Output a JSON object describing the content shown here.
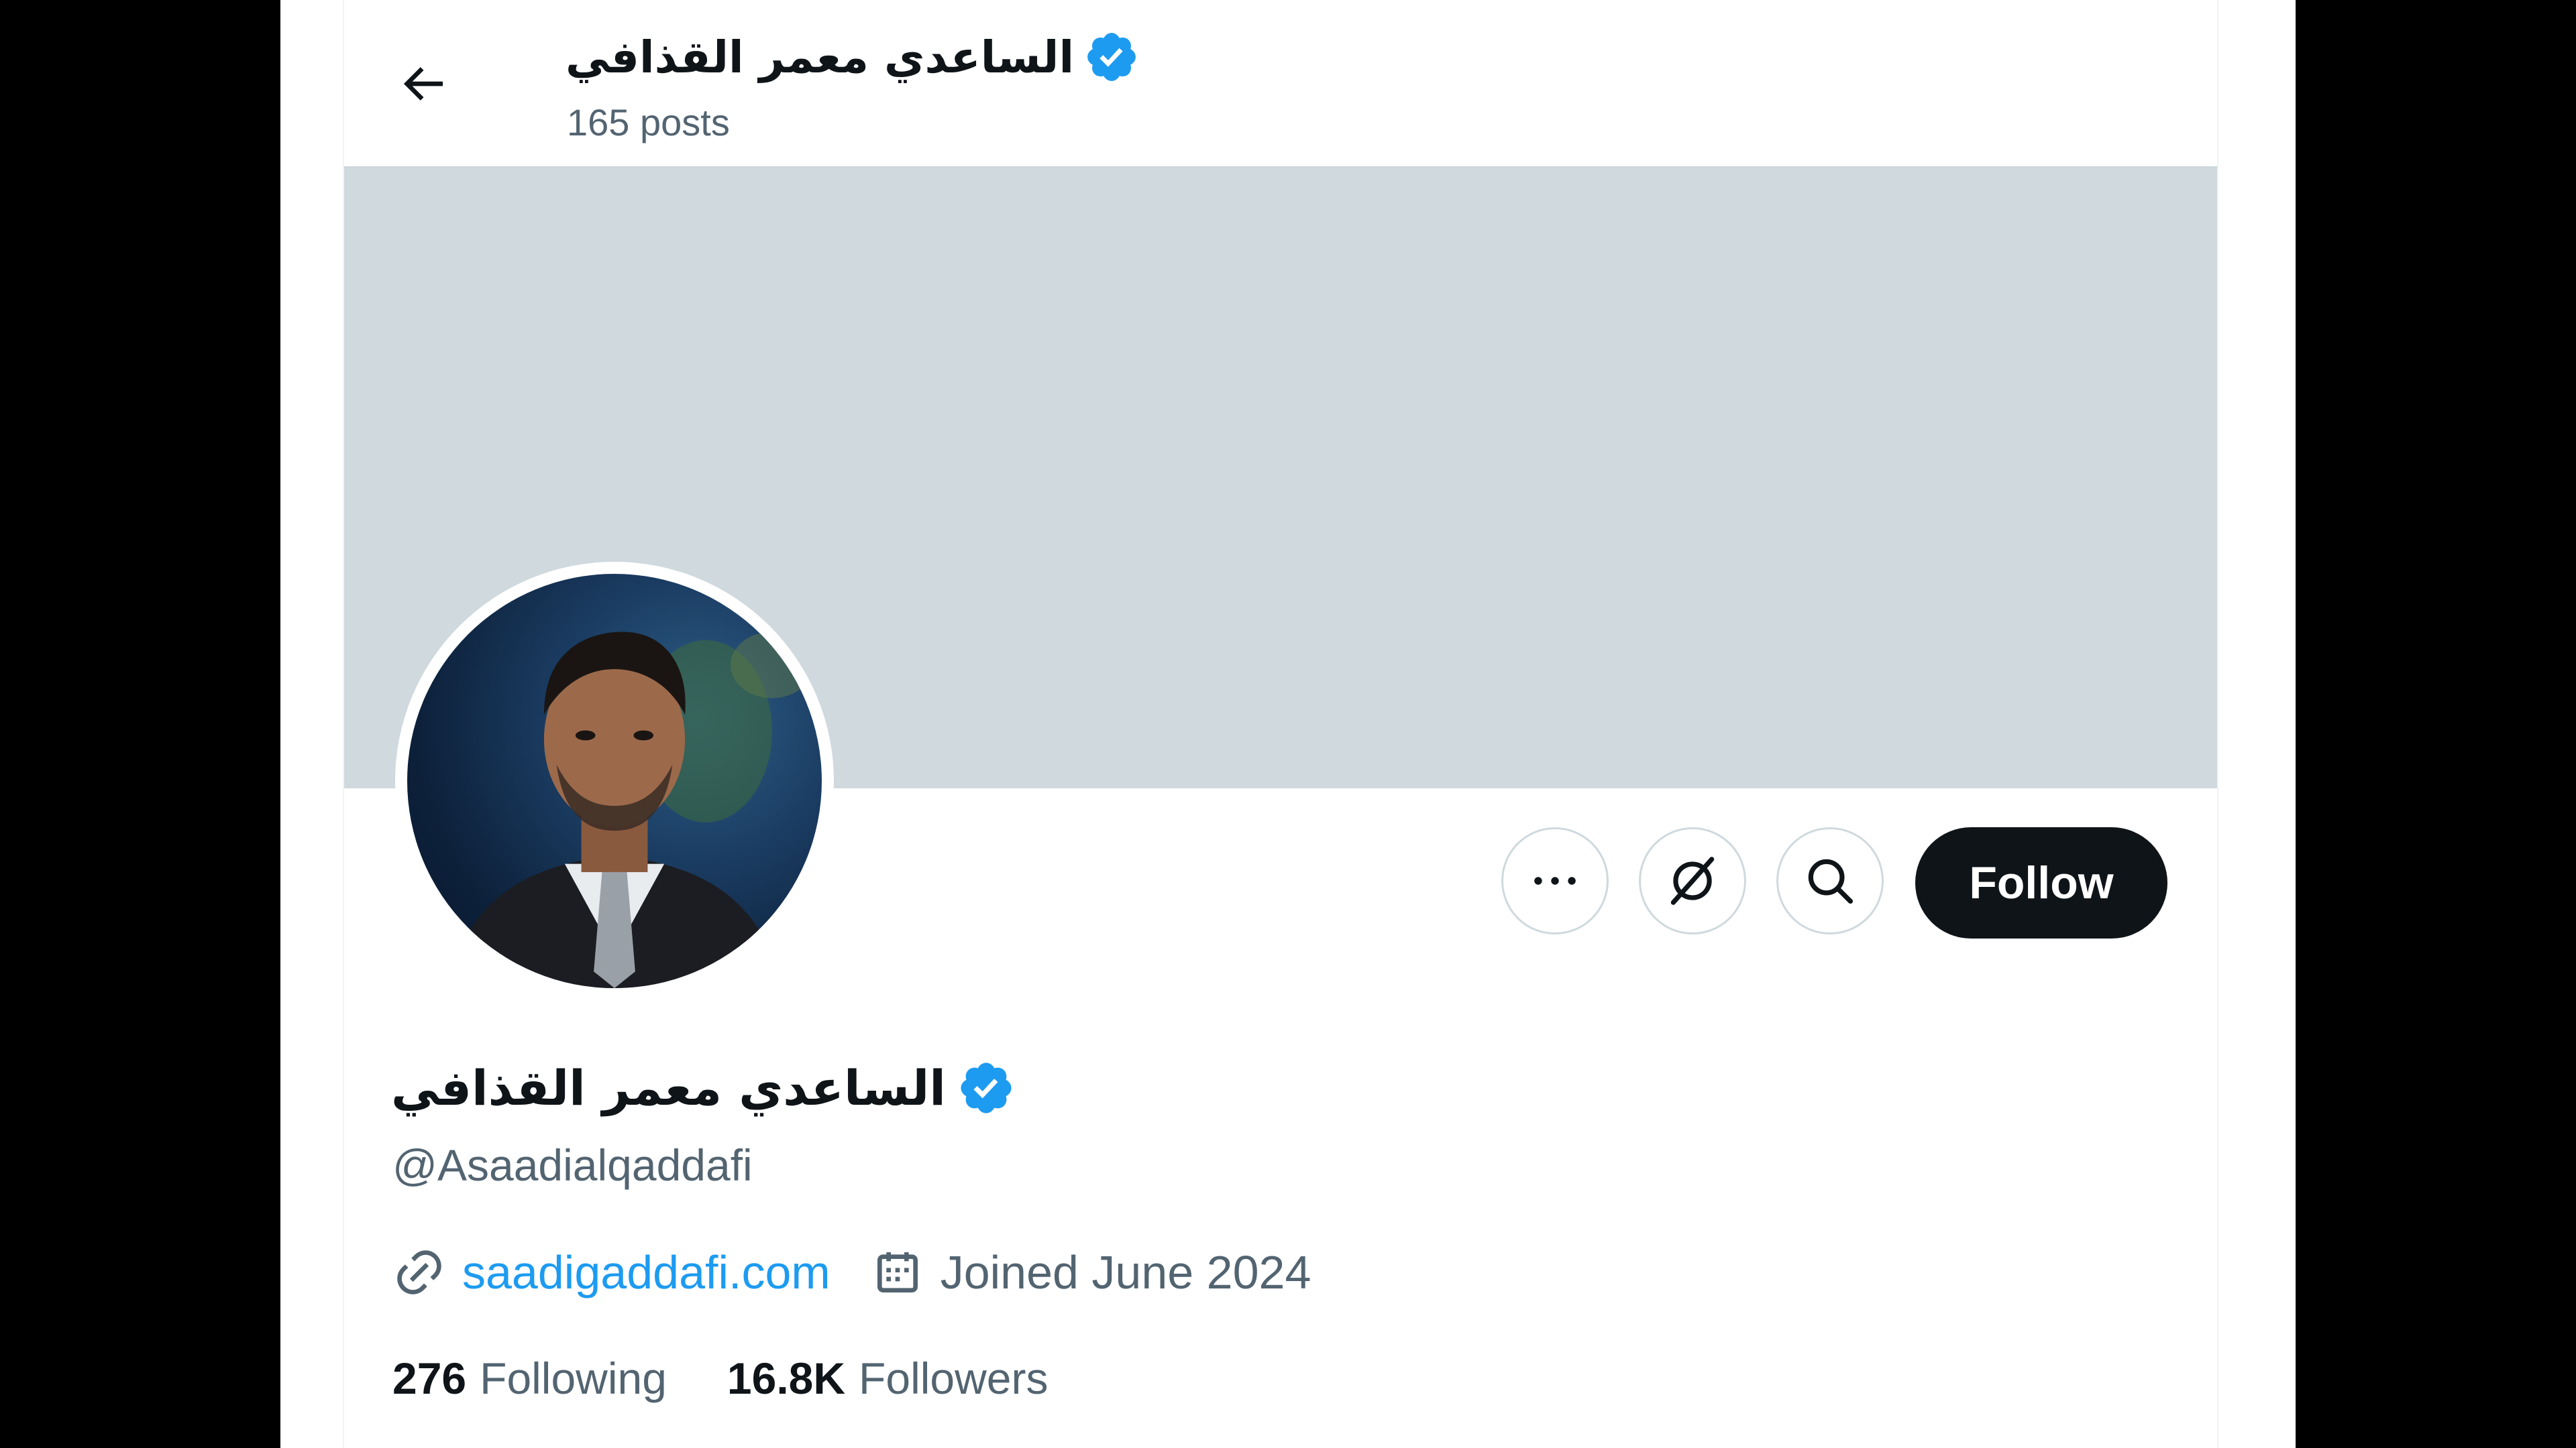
{
  "header": {
    "display_name": "الساعدي معمر القذافي",
    "posts_count": "165 posts"
  },
  "profile": {
    "display_name": "الساعدي معمر القذافي",
    "handle": "@Asaadialqaddafi",
    "verified": true,
    "website": "saadigaddafi.com",
    "joined": "Joined June 2024"
  },
  "actions": {
    "follow_label": "Follow",
    "more_icon": "more-icon",
    "grok_icon": "grok-icon",
    "search_icon": "search-icon"
  },
  "stats": {
    "following_count": "276",
    "following_label": "Following",
    "followers_count": "16.8K",
    "followers_label": "Followers"
  },
  "colors": {
    "accent": "#1d9bf0",
    "banner": "#cfd9de",
    "text_primary": "#0f1419",
    "text_secondary": "#536471",
    "follow_button": "#0f1419"
  }
}
